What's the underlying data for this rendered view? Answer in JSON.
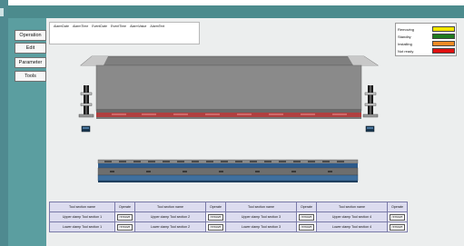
{
  "nav": {
    "operation": "Operation",
    "edit": "Edit",
    "parameter": "Parameter",
    "tools": "Tools"
  },
  "alarm_table": {
    "columns": [
      "AlarmDate",
      "AlarmTime",
      "EventDate",
      "EventTime",
      "AlarmValue",
      "AlarmText"
    ]
  },
  "legend": [
    {
      "label": "Removing",
      "color": "#f2e600"
    },
    {
      "label": "Standby",
      "color": "#1f7a1f"
    },
    {
      "label": "Installing",
      "color": "#f08a24"
    },
    {
      "label": "Not ready",
      "color": "#e01010"
    }
  ],
  "tool_table": {
    "headers": [
      "Tool section name",
      "Operate",
      "Tool section name",
      "Operate",
      "Tool section name",
      "Operate",
      "Tool section name",
      "Operate"
    ],
    "rows": [
      {
        "cells": [
          "Upper clamp Tool section 1",
          "remove",
          "Upper clamp Tool section 2",
          "remove",
          "Upper clamp Tool section 3",
          "remove",
          "Upper clamp Tool section 4",
          "remove"
        ]
      },
      {
        "cells": [
          "Lower clamp Tool section 1",
          "remove",
          "Lower clamp Tool section 2",
          "remove",
          "Lower clamp Tool section 3",
          "remove",
          "Lower clamp Tool section 4",
          "remove"
        ]
      }
    ]
  }
}
